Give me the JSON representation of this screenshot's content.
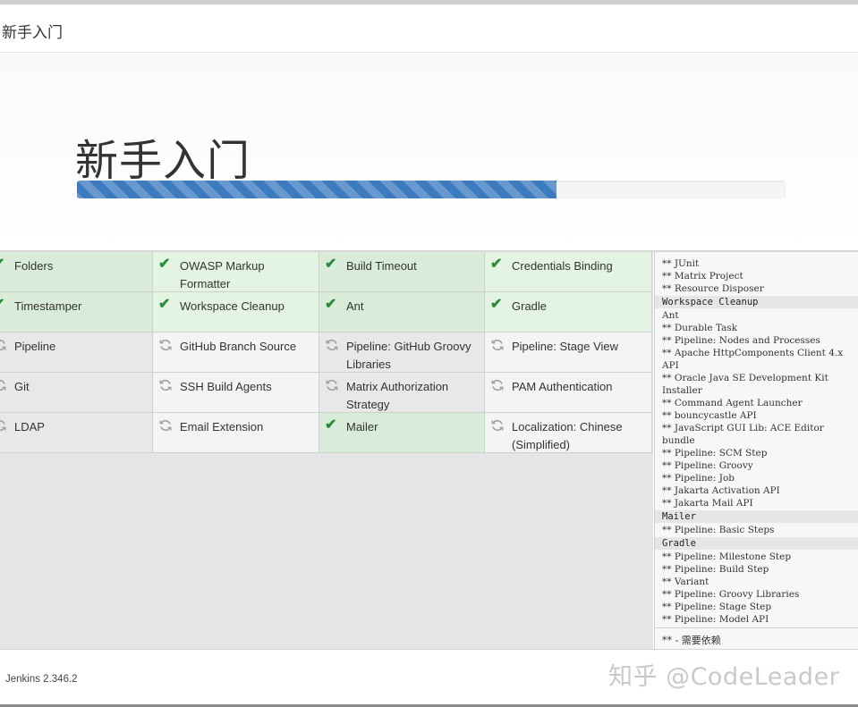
{
  "header": {
    "title": "新手入门"
  },
  "hero": {
    "title": "新手入门",
    "progress_percent": 67.7
  },
  "plugins": [
    {
      "name": "Folders",
      "status": "installed"
    },
    {
      "name": "OWASP Markup Formatter",
      "status": "installed"
    },
    {
      "name": "Build Timeout",
      "status": "installed"
    },
    {
      "name": "Credentials Binding",
      "status": "installed"
    },
    {
      "name": "Timestamper",
      "status": "installed"
    },
    {
      "name": "Workspace Cleanup",
      "status": "installed"
    },
    {
      "name": "Ant",
      "status": "installed"
    },
    {
      "name": "Gradle",
      "status": "installed"
    },
    {
      "name": "Pipeline",
      "status": "pending"
    },
    {
      "name": "GitHub Branch Source",
      "status": "pending"
    },
    {
      "name": "Pipeline: GitHub Groovy Libraries",
      "status": "pending"
    },
    {
      "name": "Pipeline: Stage View",
      "status": "pending"
    },
    {
      "name": "Git",
      "status": "pending"
    },
    {
      "name": "SSH Build Agents",
      "status": "pending"
    },
    {
      "name": "Matrix Authorization Strategy",
      "status": "pending"
    },
    {
      "name": "PAM Authentication",
      "status": "pending"
    },
    {
      "name": "LDAP",
      "status": "pending"
    },
    {
      "name": "Email Extension",
      "status": "pending"
    },
    {
      "name": "Mailer",
      "status": "installed"
    },
    {
      "name": "Localization: Chinese (Simplified)",
      "status": "pending"
    }
  ],
  "log": {
    "lines": [
      {
        "text": "** JUnit",
        "head": false
      },
      {
        "text": "** Matrix Project",
        "head": false
      },
      {
        "text": "** Resource Disposer",
        "head": false
      },
      {
        "text": "Workspace Cleanup",
        "head": true
      },
      {
        "text": "Ant",
        "head": false
      },
      {
        "text": "** Durable Task",
        "head": false
      },
      {
        "text": "** Pipeline: Nodes and Processes",
        "head": false
      },
      {
        "text": "** Apache HttpComponents Client 4.x API",
        "head": false
      },
      {
        "text": "** Oracle Java SE Development Kit Installer",
        "head": false
      },
      {
        "text": "** Command Agent Launcher",
        "head": false
      },
      {
        "text": "** bouncycastle API",
        "head": false
      },
      {
        "text": "** JavaScript GUI Lib: ACE Editor bundle",
        "head": false
      },
      {
        "text": "** Pipeline: SCM Step",
        "head": false
      },
      {
        "text": "** Pipeline: Groovy",
        "head": false
      },
      {
        "text": "** Pipeline: Job",
        "head": false
      },
      {
        "text": "** Jakarta Activation API",
        "head": false
      },
      {
        "text": "** Jakarta Mail API",
        "head": false
      },
      {
        "text": "Mailer",
        "head": true
      },
      {
        "text": "** Pipeline: Basic Steps",
        "head": false
      },
      {
        "text": "Gradle",
        "head": true
      },
      {
        "text": "** Pipeline: Milestone Step",
        "head": false
      },
      {
        "text": "** Pipeline: Build Step",
        "head": false
      },
      {
        "text": "** Variant",
        "head": false
      },
      {
        "text": "** Pipeline: Groovy Libraries",
        "head": false
      },
      {
        "text": "** Pipeline: Stage Step",
        "head": false
      },
      {
        "text": "** Pipeline: Model API",
        "head": false
      }
    ],
    "footer_note": "** - 需要依赖"
  },
  "footer": {
    "version": "Jenkins 2.346.2",
    "watermark": "知乎 @CodeLeader"
  },
  "colors": {
    "progress": "#3d7bbf",
    "check": "#2d8a3a",
    "installed_bg": "#d9ecd9",
    "pending_bg": "#e8e8e8"
  },
  "icons": {
    "installed": "check-icon",
    "pending": "refresh-icon"
  }
}
